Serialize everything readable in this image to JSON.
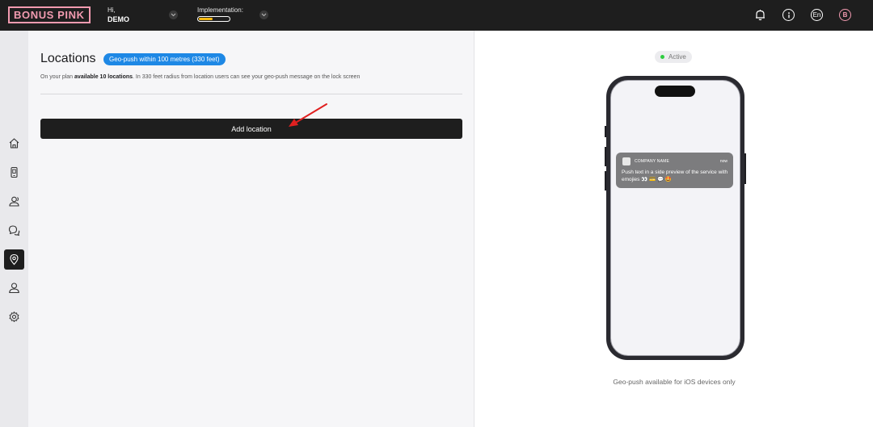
{
  "brand": {
    "logo_text": "BONUS PINK",
    "accent": "#f29bb0"
  },
  "header": {
    "greeting": "Hi,",
    "user_name": "DEMO",
    "implementation_label": "Implementation:",
    "implementation_progress": 0.45,
    "language": "En",
    "avatar_letter": "B",
    "icons": [
      "bell-icon",
      "info-icon",
      "language-icon",
      "avatar"
    ]
  },
  "sidebar": {
    "items": [
      {
        "icon": "home-icon",
        "active": false
      },
      {
        "icon": "mobile-card-icon",
        "active": false
      },
      {
        "icon": "users-icon",
        "active": false
      },
      {
        "icon": "chat-icon",
        "active": false
      },
      {
        "icon": "location-pin-icon",
        "active": true
      },
      {
        "icon": "user-icon",
        "active": false
      },
      {
        "icon": "settings-icon",
        "active": false
      }
    ]
  },
  "main": {
    "title": "Locations",
    "badge": "Geo-push within 100 metres (330 feet)",
    "plan_prefix": "On your plan ",
    "plan_bold": "available 10 locations",
    "plan_suffix": ". In 330 feet radius from location users can see your geo-push message on the lock screen",
    "add_button_label": "Add location",
    "badge_color": "#1e88e5"
  },
  "preview": {
    "status": "Active",
    "status_color": "#2ecc40",
    "notification": {
      "app_name": "COMPANY NAME",
      "time": "now",
      "body": "Push text in a side preview of the service with emojies 👀 💳 💬 🤩"
    },
    "footer_note": "Geo-push available for iOS devices only"
  }
}
